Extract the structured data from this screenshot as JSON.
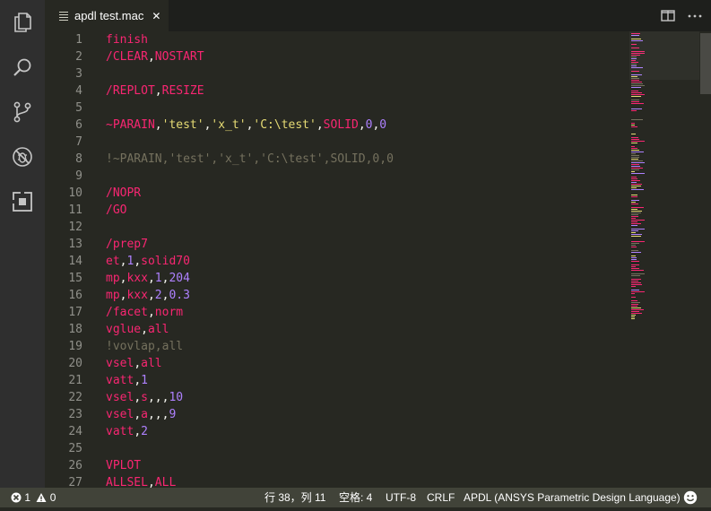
{
  "tab": {
    "title": "apdl test.mac",
    "close": "✕"
  },
  "editor": {
    "lines": [
      {
        "n": "1",
        "tokens": [
          {
            "t": "finish",
            "c": "#f92672"
          }
        ]
      },
      {
        "n": "2",
        "tokens": [
          {
            "t": "/CLEAR",
            "c": "#f92672"
          },
          {
            "t": ",",
            "c": "#f8f8f2"
          },
          {
            "t": "NOSTART",
            "c": "#f92672"
          }
        ]
      },
      {
        "n": "3",
        "tokens": []
      },
      {
        "n": "4",
        "tokens": [
          {
            "t": "/REPLOT",
            "c": "#f92672"
          },
          {
            "t": ",",
            "c": "#f8f8f2"
          },
          {
            "t": "RESIZE",
            "c": "#f92672"
          }
        ]
      },
      {
        "n": "5",
        "tokens": []
      },
      {
        "n": "6",
        "tokens": [
          {
            "t": "~PARAIN",
            "c": "#f92672"
          },
          {
            "t": ",",
            "c": "#f8f8f2"
          },
          {
            "t": "'test'",
            "c": "#e6db74"
          },
          {
            "t": ",",
            "c": "#f8f8f2"
          },
          {
            "t": "'x_t'",
            "c": "#e6db74"
          },
          {
            "t": ",",
            "c": "#f8f8f2"
          },
          {
            "t": "'C:\\test'",
            "c": "#e6db74"
          },
          {
            "t": ",",
            "c": "#f8f8f2"
          },
          {
            "t": "SOLID",
            "c": "#f92672"
          },
          {
            "t": ",",
            "c": "#f8f8f2"
          },
          {
            "t": "0",
            "c": "#ae81ff"
          },
          {
            "t": ",",
            "c": "#f8f8f2"
          },
          {
            "t": "0",
            "c": "#ae81ff"
          }
        ]
      },
      {
        "n": "7",
        "tokens": []
      },
      {
        "n": "8",
        "tokens": [
          {
            "t": "!~PARAIN,'test','x_t','C:\\test',SOLID,0,0",
            "c": "#75715e"
          }
        ]
      },
      {
        "n": "9",
        "tokens": []
      },
      {
        "n": "10",
        "tokens": [
          {
            "t": "/NOPR",
            "c": "#f92672"
          }
        ]
      },
      {
        "n": "11",
        "tokens": [
          {
            "t": "/GO",
            "c": "#f92672"
          }
        ]
      },
      {
        "n": "12",
        "tokens": []
      },
      {
        "n": "13",
        "tokens": [
          {
            "t": "/prep7",
            "c": "#f92672"
          }
        ]
      },
      {
        "n": "14",
        "tokens": [
          {
            "t": "et",
            "c": "#f92672"
          },
          {
            "t": ",",
            "c": "#f8f8f2"
          },
          {
            "t": "1",
            "c": "#ae81ff"
          },
          {
            "t": ",",
            "c": "#f8f8f2"
          },
          {
            "t": "solid70",
            "c": "#f92672"
          }
        ]
      },
      {
        "n": "15",
        "tokens": [
          {
            "t": "mp",
            "c": "#f92672"
          },
          {
            "t": ",",
            "c": "#f8f8f2"
          },
          {
            "t": "kxx",
            "c": "#f92672"
          },
          {
            "t": ",",
            "c": "#f8f8f2"
          },
          {
            "t": "1",
            "c": "#ae81ff"
          },
          {
            "t": ",",
            "c": "#f8f8f2"
          },
          {
            "t": "204",
            "c": "#ae81ff"
          }
        ]
      },
      {
        "n": "16",
        "tokens": [
          {
            "t": "mp",
            "c": "#f92672"
          },
          {
            "t": ",",
            "c": "#f8f8f2"
          },
          {
            "t": "kxx",
            "c": "#f92672"
          },
          {
            "t": ",",
            "c": "#f8f8f2"
          },
          {
            "t": "2",
            "c": "#ae81ff"
          },
          {
            "t": ",",
            "c": "#f8f8f2"
          },
          {
            "t": "0.3",
            "c": "#ae81ff"
          }
        ]
      },
      {
        "n": "17",
        "tokens": [
          {
            "t": "/facet",
            "c": "#f92672"
          },
          {
            "t": ",",
            "c": "#f8f8f2"
          },
          {
            "t": "norm",
            "c": "#f92672"
          }
        ]
      },
      {
        "n": "18",
        "tokens": [
          {
            "t": "vglue",
            "c": "#f92672"
          },
          {
            "t": ",",
            "c": "#f8f8f2"
          },
          {
            "t": "all",
            "c": "#f92672"
          }
        ]
      },
      {
        "n": "19",
        "tokens": [
          {
            "t": "!vovlap,all",
            "c": "#75715e"
          }
        ]
      },
      {
        "n": "20",
        "tokens": [
          {
            "t": "vsel",
            "c": "#f92672"
          },
          {
            "t": ",",
            "c": "#f8f8f2"
          },
          {
            "t": "all",
            "c": "#f92672"
          }
        ]
      },
      {
        "n": "21",
        "tokens": [
          {
            "t": "vatt",
            "c": "#f92672"
          },
          {
            "t": ",",
            "c": "#f8f8f2"
          },
          {
            "t": "1",
            "c": "#ae81ff"
          }
        ]
      },
      {
        "n": "22",
        "tokens": [
          {
            "t": "vsel",
            "c": "#f92672"
          },
          {
            "t": ",",
            "c": "#f8f8f2"
          },
          {
            "t": "s",
            "c": "#f92672"
          },
          {
            "t": ",,,",
            "c": "#f8f8f2"
          },
          {
            "t": "10",
            "c": "#ae81ff"
          }
        ]
      },
      {
        "n": "23",
        "tokens": [
          {
            "t": "vsel",
            "c": "#f92672"
          },
          {
            "t": ",",
            "c": "#f8f8f2"
          },
          {
            "t": "a",
            "c": "#f92672"
          },
          {
            "t": ",,,",
            "c": "#f8f8f2"
          },
          {
            "t": "9",
            "c": "#ae81ff"
          }
        ]
      },
      {
        "n": "24",
        "tokens": [
          {
            "t": "vatt",
            "c": "#f92672"
          },
          {
            "t": ",",
            "c": "#f8f8f2"
          },
          {
            "t": "2",
            "c": "#ae81ff"
          }
        ]
      },
      {
        "n": "25",
        "tokens": []
      },
      {
        "n": "26",
        "tokens": [
          {
            "t": "VPLOT",
            "c": "#f92672"
          }
        ]
      },
      {
        "n": "27",
        "tokens": [
          {
            "t": "ALLSEL",
            "c": "#f92672"
          },
          {
            "t": ",",
            "c": "#f8f8f2"
          },
          {
            "t": "ALL",
            "c": "#f92672"
          }
        ]
      }
    ]
  },
  "status": {
    "errors": "1",
    "warnings": "0",
    "position": "行 38，列 11",
    "indent": "空格: 4",
    "encoding": "UTF-8",
    "eol": "CRLF",
    "language": "APDL (ANSYS Parametric Design Language)"
  },
  "icons": {
    "activity": [
      "explorer-icon",
      "search-icon",
      "source-control-icon",
      "debug-icon",
      "extensions-icon"
    ],
    "tab": [
      "split-editor-icon",
      "more-icon"
    ],
    "status": [
      "error-icon",
      "warning-icon",
      "feedback-smiley-icon"
    ]
  },
  "colors": {
    "keyword": "#f92672",
    "string": "#e6db74",
    "number": "#ae81ff",
    "comment": "#75715e",
    "background": "#272822",
    "statusbar": "#414339"
  }
}
